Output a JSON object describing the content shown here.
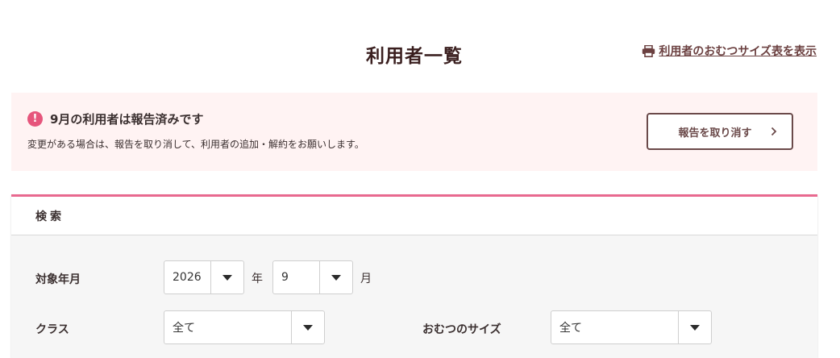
{
  "header": {
    "title": "利用者一覧",
    "print_link_label": "利用者のおむつサイズ表を表示",
    "print_icon": "printer-icon"
  },
  "alert": {
    "icon": "exclamation-circle-icon",
    "icon_glyph": "!",
    "heading": "9月の利用者は報告済みです",
    "message": "変更がある場合は、報告を取り消して、利用者の追加・解約をお願いします。",
    "cancel_button_label": "報告を取り消す",
    "accent_color": "#e6557c",
    "background_color": "#fff3f3"
  },
  "search": {
    "heading": "検索",
    "accent_color": "#e8698f",
    "target_month_label": "対象年月",
    "year_value": "2026",
    "year_unit": "年",
    "month_value": "9",
    "month_unit": "月",
    "class_label": "クラス",
    "class_value": "全て",
    "diaper_size_label": "おむつのサイズ",
    "diaper_size_value": "全て"
  }
}
